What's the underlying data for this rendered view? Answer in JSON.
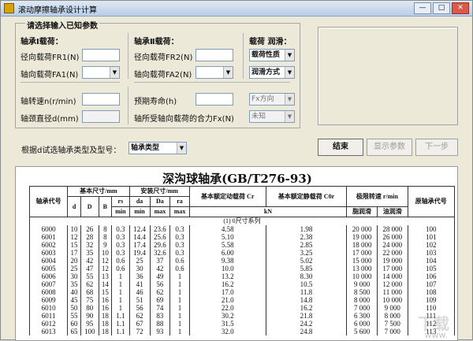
{
  "window": {
    "title": "滚动摩擦轴承设计计算",
    "min": "—",
    "max": "□",
    "close": "✕"
  },
  "input_group": {
    "title": "请选择输入已知参数",
    "load1": {
      "heading": "轴承Ⅰ载荷：",
      "fr1": "径向载荷FR1(N)",
      "fa1": "轴向载荷FA1(N)"
    },
    "load2": {
      "heading": "轴承Ⅱ载荷：",
      "fr2": "径向载荷FR2(N)",
      "fa2": "轴向载荷FA2(N)"
    },
    "load_lub": {
      "heading": "载荷 润滑：",
      "load_nature": "载荷性质",
      "lub_method": "润滑方式"
    },
    "speed": "轴转速n(r/min)",
    "neck": "轴颈直径d(mm)",
    "life": "预期寿命(h)",
    "fx_label": "轴所受轴向载荷的合力Fx(N)",
    "fx_dir": "Fx方向",
    "fx_val": "未知"
  },
  "select_row": {
    "label": "根据d试选轴承类型及型号：",
    "type_value": "轴承类型"
  },
  "buttons": {
    "finish": "结束",
    "show": "显示参数",
    "next": "下一步"
  },
  "table": {
    "title": "深沟球轴承(GB/T276-93)",
    "headers": {
      "code": "轴承代号",
      "basic": "基本尺寸/mm",
      "install": "安装尺寸/mm",
      "cr": "基本额定动载荷 Cr",
      "c0r": "基本额定静载荷 C0r",
      "limit": "极限转速 r/min",
      "orig": "原轴承代号",
      "d": "d",
      "D": "D",
      "B": "B",
      "rs": "rs",
      "da": "da",
      "Da": "Da",
      "ra": "ra",
      "min": "min",
      "max": "max",
      "kN": "kN",
      "grease": "脂润滑",
      "oil": "油润滑"
    },
    "section": "(1) 0尺寸系列",
    "rows": [
      [
        "6000",
        "10",
        "26",
        "8",
        "0.3",
        "12.4",
        "23.6",
        "0.3",
        "4.58",
        "1.98",
        "20 000",
        "28 000",
        "100"
      ],
      [
        "6001",
        "12",
        "28",
        "8",
        "0.3",
        "14.4",
        "25.6",
        "0.3",
        "5.10",
        "2.38",
        "19 000",
        "26 000",
        "101"
      ],
      [
        "6002",
        "15",
        "32",
        "9",
        "0.3",
        "17.4",
        "29.6",
        "0.3",
        "5.58",
        "2.85",
        "18 000",
        "24 000",
        "102"
      ],
      [
        "6003",
        "17",
        "35",
        "10",
        "0.3",
        "19.4",
        "32.6",
        "0.3",
        "6.00",
        "3.25",
        "17 000",
        "22 000",
        "103"
      ],
      [
        "6004",
        "20",
        "42",
        "12",
        "0.6",
        "25",
        "37",
        "0.6",
        "9.38",
        "5.02",
        "15 000",
        "19 000",
        "104"
      ],
      [
        "6005",
        "25",
        "47",
        "12",
        "0.6",
        "30",
        "42",
        "0.6",
        "10.0",
        "5.85",
        "13 000",
        "17 000",
        "105"
      ],
      [
        "6006",
        "30",
        "55",
        "13",
        "1",
        "36",
        "49",
        "1",
        "13.2",
        "8.30",
        "10 000",
        "14 000",
        "106"
      ],
      [
        "6007",
        "35",
        "62",
        "14",
        "1",
        "41",
        "56",
        "1",
        "16.2",
        "10.5",
        "9 000",
        "12 000",
        "107"
      ],
      [
        "6008",
        "40",
        "68",
        "15",
        "1",
        "46",
        "62",
        "1",
        "17.0",
        "11.8",
        "8 500",
        "11 000",
        "108"
      ],
      [
        "6009",
        "45",
        "75",
        "16",
        "1",
        "51",
        "69",
        "1",
        "21.0",
        "14.8",
        "8 000",
        "10 000",
        "109"
      ],
      [
        "6010",
        "50",
        "80",
        "16",
        "1",
        "56",
        "74",
        "1",
        "22.0",
        "16.2",
        "7 000",
        "9 000",
        "110"
      ],
      [
        "6011",
        "55",
        "90",
        "18",
        "1.1",
        "62",
        "83",
        "1",
        "30.2",
        "21.8",
        "6 300",
        "8 000",
        "111"
      ],
      [
        "6012",
        "60",
        "95",
        "18",
        "1.1",
        "67",
        "88",
        "1",
        "31.5",
        "24.2",
        "6 000",
        "7 500",
        "112"
      ],
      [
        "6013",
        "65",
        "100",
        "18",
        "1.1",
        "72",
        "93",
        "1",
        "32.0",
        "24.8",
        "5 600",
        "7 000",
        "113"
      ]
    ]
  }
}
